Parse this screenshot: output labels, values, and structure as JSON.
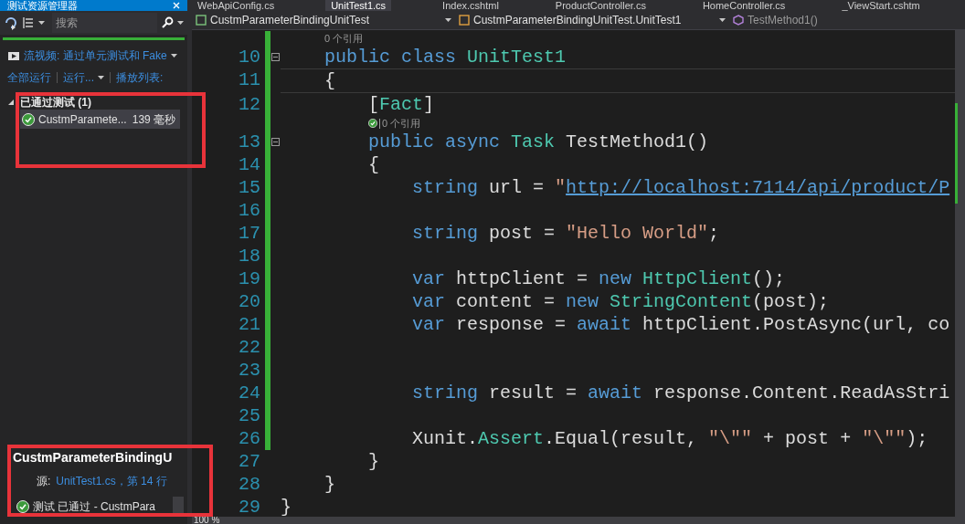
{
  "explorer": {
    "title": "测试资源管理器",
    "search": {
      "placeholder": "搜索"
    },
    "playlist_link": "流视频: 通过单元测试和 Fake",
    "actions": [
      "全部运行",
      "运行...",
      "播放列表:"
    ],
    "tree": [
      {
        "label": "已通过测试 (1)",
        "expanded": true,
        "children": [
          {
            "name": "CustmParamete...",
            "duration": "139 毫秒",
            "passed": true,
            "selected": true
          }
        ]
      }
    ],
    "detail": {
      "title": "CustmParameterBindingU",
      "source_label": "源:",
      "source_link": "UnitTest1.cs，第 14 行",
      "result": "测试 已通过 - CustmPara",
      "passed": true
    }
  },
  "tabs": [
    {
      "label": "WebApiConfig.cs",
      "selected": false
    },
    {
      "label": "UnitTest1.cs",
      "selected": true
    },
    {
      "label": "Index.cshtml",
      "selected": false
    },
    {
      "label": "ProductController.cs",
      "selected": false
    },
    {
      "label": "HomeController.cs",
      "selected": false
    },
    {
      "label": "_ViewStart.cshtm",
      "selected": false
    }
  ],
  "nav": [
    "CustmParameterBindingUnitTest",
    "CustmParameterBindingUnitTest.UnitTest1",
    "TestMethod1()"
  ],
  "code": [
    {
      "number": "10",
      "lens": {
        "text": "0 个引用"
      },
      "changed": true,
      "collapsible": true,
      "tokens": [
        {
          "kind": "kw",
          "text": "    public class "
        },
        {
          "kind": "type",
          "text": "UnitTest1"
        }
      ]
    },
    {
      "number": "11",
      "changed": true,
      "tokens": [
        {
          "kind": "plain",
          "text": "    {"
        }
      ]
    },
    {
      "number": "12",
      "changed": true,
      "tokens": [
        {
          "kind": "plain",
          "text": "        ["
        },
        {
          "kind": "type",
          "text": "Fact"
        },
        {
          "kind": "plain",
          "text": "]"
        }
      ]
    },
    {
      "number": "13",
      "lens": {
        "text": "0 个引用",
        "passed": true
      },
      "changed": true,
      "collapsible": true,
      "tokens": [
        {
          "kind": "kw",
          "text": "        public async "
        },
        {
          "kind": "type",
          "text": "Task"
        },
        {
          "kind": "plain",
          "text": " TestMethod1()"
        }
      ]
    },
    {
      "number": "14",
      "changed": true,
      "tokens": [
        {
          "kind": "plain",
          "text": "        {"
        }
      ]
    },
    {
      "number": "15",
      "changed": true,
      "tokens": [
        {
          "kind": "kw",
          "text": "            string "
        },
        {
          "kind": "plain",
          "text": "url = "
        },
        {
          "kind": "str",
          "text": "\""
        },
        {
          "kind": "url",
          "text": "http://localhost:7114/api/product/P"
        }
      ]
    },
    {
      "number": "16",
      "changed": true
    },
    {
      "number": "17",
      "changed": true,
      "tokens": [
        {
          "kind": "kw",
          "text": "            string "
        },
        {
          "kind": "plain",
          "text": "post = "
        },
        {
          "kind": "str",
          "text": "\"Hello World\""
        },
        {
          "kind": "plain",
          "text": ";"
        }
      ]
    },
    {
      "number": "18",
      "changed": true
    },
    {
      "number": "19",
      "changed": true,
      "tokens": [
        {
          "kind": "kw",
          "text": "            var "
        },
        {
          "kind": "plain",
          "text": "httpClient = "
        },
        {
          "kind": "kw",
          "text": "new "
        },
        {
          "kind": "type",
          "text": "HttpClient"
        },
        {
          "kind": "plain",
          "text": "();"
        }
      ]
    },
    {
      "number": "20",
      "changed": true,
      "tokens": [
        {
          "kind": "kw",
          "text": "            var "
        },
        {
          "kind": "plain",
          "text": "content = "
        },
        {
          "kind": "kw",
          "text": "new "
        },
        {
          "kind": "type",
          "text": "StringContent"
        },
        {
          "kind": "plain",
          "text": "(post);"
        }
      ]
    },
    {
      "number": "21",
      "changed": true,
      "tokens": [
        {
          "kind": "kw",
          "text": "            var "
        },
        {
          "kind": "plain",
          "text": "response = "
        },
        {
          "kind": "kw",
          "text": "await "
        },
        {
          "kind": "plain",
          "text": "httpClient.PostAsync(url, co"
        }
      ]
    },
    {
      "number": "22",
      "changed": true
    },
    {
      "number": "23",
      "changed": true
    },
    {
      "number": "24",
      "changed": true,
      "tokens": [
        {
          "kind": "kw",
          "text": "            string "
        },
        {
          "kind": "plain",
          "text": "result = "
        },
        {
          "kind": "kw",
          "text": "await "
        },
        {
          "kind": "plain",
          "text": "response.Content.ReadAsStri"
        }
      ]
    },
    {
      "number": "25",
      "changed": true
    },
    {
      "number": "26",
      "changed": true,
      "tokens": [
        {
          "kind": "plain",
          "text": "            Xunit."
        },
        {
          "kind": "type",
          "text": "Assert"
        },
        {
          "kind": "plain",
          "text": ".Equal(result, "
        },
        {
          "kind": "str",
          "text": "\"\\\"\""
        },
        {
          "kind": "plain",
          "text": " + post + "
        },
        {
          "kind": "str",
          "text": "\"\\\"\""
        },
        {
          "kind": "plain",
          "text": ");"
        }
      ]
    },
    {
      "number": "27",
      "changed": false,
      "tokens": [
        {
          "kind": "plain",
          "text": "        }"
        }
      ]
    },
    {
      "number": "28",
      "changed": false,
      "tokens": [
        {
          "kind": "plain",
          "text": "    }"
        }
      ]
    },
    {
      "number": "29",
      "changed": false,
      "tokens": [
        {
          "kind": "plain",
          "text": "}"
        }
      ]
    }
  ],
  "zoom": "100 %"
}
